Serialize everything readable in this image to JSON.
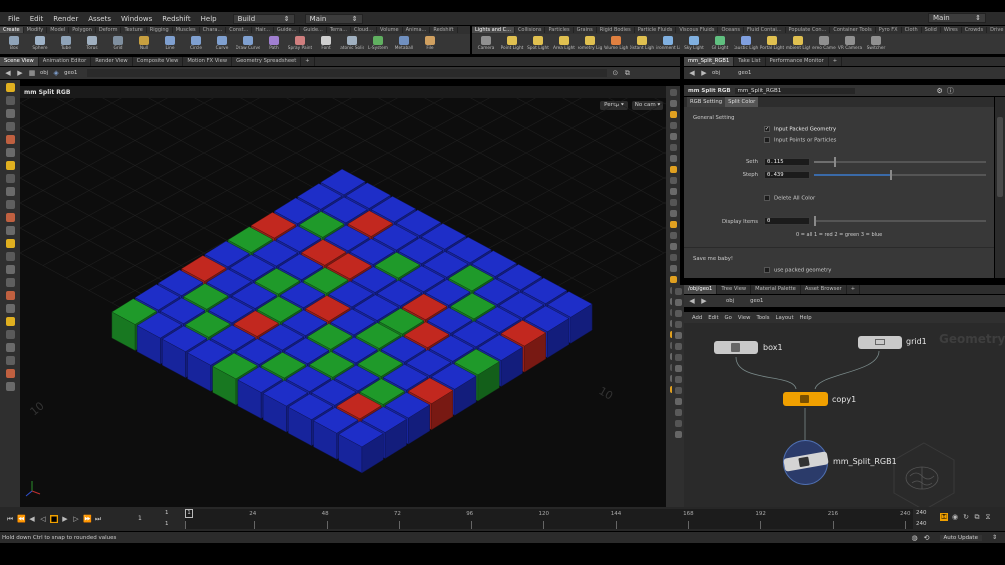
{
  "menu": {
    "items": [
      "File",
      "Edit",
      "Render",
      "Assets",
      "Windows",
      "Redshift",
      "Help"
    ],
    "desktop": "Build",
    "main": "Main",
    "main_right": "Main"
  },
  "shelf_left": {
    "tabs": [
      "Create",
      "Modify",
      "Model",
      "Polygon",
      "Deform",
      "Texture",
      "Rigging",
      "Muscles",
      "Chara...",
      "Const...",
      "Hair...",
      "Guide...",
      "Guide...",
      "Terra...",
      "Cloud...",
      "Volume",
      "Anima...",
      "Redshift"
    ],
    "tools": [
      {
        "label": "Box",
        "color": "#8fa3b8"
      },
      {
        "label": "Sphere",
        "color": "#9fb3c8"
      },
      {
        "label": "Tube",
        "color": "#8fa3b8"
      },
      {
        "label": "Torus",
        "color": "#a0b0c0"
      },
      {
        "label": "Grid",
        "color": "#7f8f9f"
      },
      {
        "label": "Null",
        "color": "#c8a040"
      },
      {
        "label": "Line",
        "color": "#7fa0d0"
      },
      {
        "label": "Circle",
        "color": "#7fa0d0"
      },
      {
        "label": "Curve",
        "color": "#7fa0d0"
      },
      {
        "label": "Draw Curve",
        "color": "#7fa0d0"
      },
      {
        "label": "Path",
        "color": "#a07fd0"
      },
      {
        "label": "Spray Paint",
        "color": "#d07f7f"
      },
      {
        "label": "Font",
        "color": "#d0d0d0"
      },
      {
        "label": "Platonic Solids",
        "color": "#a0b0c0"
      },
      {
        "label": "L-System",
        "color": "#60b060"
      },
      {
        "label": "Metaball",
        "color": "#7090c0"
      },
      {
        "label": "File",
        "color": "#d0a060"
      }
    ]
  },
  "shelf_right": {
    "tabs": [
      "Lights and C...",
      "Collisions",
      "Particles",
      "Grains",
      "Rigid Bodies",
      "Particle Fluids",
      "Viscous Fluids",
      "Oceans",
      "Fluid Contai...",
      "Populate Con...",
      "Container Tools",
      "Pyro FX",
      "Cloth",
      "Solid",
      "Wires",
      "Crowds",
      "Drive Simula..."
    ],
    "tools": [
      {
        "label": "Camera",
        "color": "#909090"
      },
      {
        "label": "Point Light",
        "color": "#e0c050"
      },
      {
        "label": "Spot Light",
        "color": "#e0c050"
      },
      {
        "label": "Area Light",
        "color": "#e0c050"
      },
      {
        "label": "Geometry Light",
        "color": "#e0c050"
      },
      {
        "label": "Volume Light",
        "color": "#e08040"
      },
      {
        "label": "Distant Light",
        "color": "#e0c050"
      },
      {
        "label": "Environment Light",
        "color": "#80b0e0"
      },
      {
        "label": "Sky Light",
        "color": "#80b0e0"
      },
      {
        "label": "GI Light",
        "color": "#60c080"
      },
      {
        "label": "Caustic Light",
        "color": "#80a0e0"
      },
      {
        "label": "Portal Light",
        "color": "#e0c050"
      },
      {
        "label": "Ambient Light",
        "color": "#e0c050"
      },
      {
        "label": "Stereo Camera",
        "color": "#909090"
      },
      {
        "label": "VR Camera",
        "color": "#909090"
      },
      {
        "label": "Switcher",
        "color": "#909090"
      }
    ]
  },
  "left_tabs": [
    "Scene View",
    "Animation Editor",
    "Render View",
    "Composite View",
    "Motion FX View",
    "Geometry Spreadsheet"
  ],
  "left_path": {
    "root": "obj",
    "node": "geo1"
  },
  "viewport": {
    "title": "mm Split RGB",
    "persp": "Persp",
    "cam": "No cam",
    "grid_label_1": "10",
    "grid_label_2": "10"
  },
  "param_tabs": [
    "mm_Split_RGB1",
    "Take List",
    "Performance Monitor"
  ],
  "param_path": {
    "root": "obj",
    "node": "geo1"
  },
  "param": {
    "node_type": "mm Split RGB",
    "node_name": "mm_Split_RGB1",
    "tabs": [
      "RGB Setting",
      "Split Color"
    ],
    "section": "General Setting",
    "input_packed": "Input Packed Geometry",
    "input_points": "Input Points or Particles",
    "seth_label": "Seth",
    "seth_value": "0.115",
    "seth_fraction": 0.115,
    "steph_label": "Steph",
    "steph_value": "0.439",
    "steph_fraction": 0.439,
    "delete_all": "Delete All Color",
    "display_label": "Display Items",
    "display_value": "0",
    "display_hint": "0 = all   1 = red   2 = green   3 = blue",
    "save_label": "Save me baby!",
    "use_packed": "use packed geometry"
  },
  "network_tabs": [
    "/obj/geo1",
    "Tree View",
    "Material Palette",
    "Asset Browser"
  ],
  "network_path": {
    "root": "obj",
    "node": "geo1"
  },
  "network_menu": [
    "Add",
    "Edit",
    "Go",
    "View",
    "Tools",
    "Layout",
    "Help"
  ],
  "network": {
    "watermark": "Geometry",
    "nodes": {
      "box": "box1",
      "grid": "grid1",
      "copy": "copy1",
      "split": "mm_Split_RGB1"
    }
  },
  "timeline": {
    "current_frame": "1",
    "start": "1",
    "end_a": "1",
    "ticks": [
      "1",
      "24",
      "48",
      "72",
      "96",
      "120",
      "144",
      "168",
      "192",
      "216",
      "240"
    ],
    "end_top": "240",
    "end_bottom": "240"
  },
  "status": {
    "message": "Hold down Ctrl to snap to rounded values",
    "update": "Auto Update"
  },
  "colors": {
    "red": "#c2281f",
    "green": "#1f9a2a",
    "blue": "#1e2ec8",
    "accent": "#f0a000"
  },
  "grid_colors": [
    "BBBBBBBBBB",
    "BBRBBBGBBB",
    "BGBBGBBGBR",
    "RBRRBBRBBB",
    "GBBGBBGRBG",
    "BBGBRBGBBB",
    "RBBGBGBGBR",
    "BGBRBBGBGB",
    "BBGBBGBBRB",
    "GBBBGBBBBB"
  ]
}
